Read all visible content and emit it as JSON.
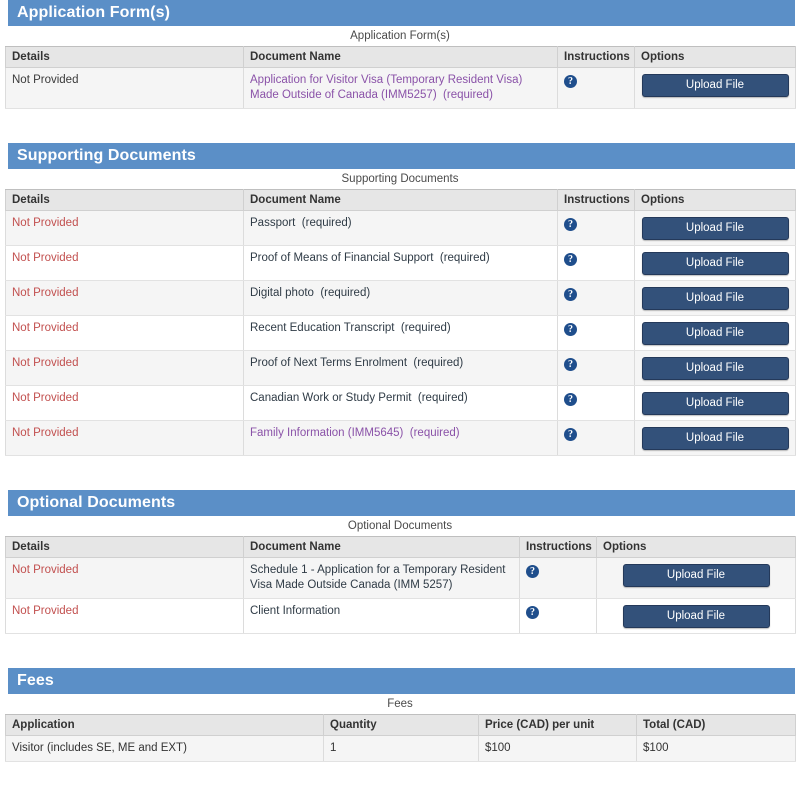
{
  "sections": [
    {
      "id": "application-forms",
      "title": "Application Form(s)",
      "caption": "Application Form(s)",
      "columns": [
        "Details",
        "Document Name",
        "Instructions",
        "Options"
      ],
      "rows": [
        {
          "details": "Not Provided",
          "details_style": "plain",
          "document_name": "Application for Visitor Visa (Temporary Resident Visa) Made Outside of Canada (IMM5257)",
          "required_label": "(required)",
          "name_style": "link",
          "instructions_icon": "help-icon",
          "upload_label": "Upload File"
        }
      ]
    },
    {
      "id": "supporting-documents",
      "title": "Supporting Documents",
      "caption": "Supporting Documents",
      "columns": [
        "Details",
        "Document Name",
        "Instructions",
        "Options"
      ],
      "rows": [
        {
          "details": "Not Provided",
          "details_style": "red",
          "document_name": "Passport",
          "required_label": "(required)",
          "name_style": "plain",
          "instructions_icon": "help-icon",
          "upload_label": "Upload File"
        },
        {
          "details": "Not Provided",
          "details_style": "red",
          "document_name": "Proof of Means of Financial Support",
          "required_label": "(required)",
          "name_style": "plain",
          "instructions_icon": "help-icon",
          "upload_label": "Upload File"
        },
        {
          "details": "Not Provided",
          "details_style": "red",
          "document_name": "Digital photo",
          "required_label": "(required)",
          "name_style": "plain",
          "instructions_icon": "help-icon",
          "upload_label": "Upload File"
        },
        {
          "details": "Not Provided",
          "details_style": "red",
          "document_name": "Recent Education Transcript",
          "required_label": "(required)",
          "name_style": "plain",
          "instructions_icon": "help-icon",
          "upload_label": "Upload File"
        },
        {
          "details": "Not Provided",
          "details_style": "red",
          "document_name": "Proof of Next Terms Enrolment",
          "required_label": "(required)",
          "name_style": "plain",
          "instructions_icon": "help-icon",
          "upload_label": "Upload File"
        },
        {
          "details": "Not Provided",
          "details_style": "red",
          "document_name": "Canadian Work or Study Permit",
          "required_label": "(required)",
          "name_style": "plain",
          "instructions_icon": "help-icon",
          "upload_label": "Upload File"
        },
        {
          "details": "Not Provided",
          "details_style": "red",
          "document_name": "Family Information (IMM5645)",
          "required_label": "(required)",
          "name_style": "link",
          "instructions_icon": "help-icon",
          "upload_label": "Upload File"
        }
      ]
    },
    {
      "id": "optional-documents",
      "title": "Optional Documents",
      "caption": "Optional Documents",
      "columns": [
        "Details",
        "Document Name",
        "Instructions",
        "Options"
      ],
      "rows": [
        {
          "details": "Not Provided",
          "details_style": "red",
          "document_name": "Schedule 1 - Application for a Temporary Resident Visa Made Outside Canada (IMM 5257)",
          "required_label": "",
          "name_style": "plain",
          "instructions_icon": "help-icon",
          "upload_label": "Upload File"
        },
        {
          "details": "Not Provided",
          "details_style": "red",
          "document_name": "Client Information",
          "required_label": "",
          "name_style": "plain",
          "instructions_icon": "help-icon",
          "upload_label": "Upload File"
        }
      ]
    }
  ],
  "fees": {
    "id": "fees",
    "title": "Fees",
    "caption": "Fees",
    "columns": [
      "Application",
      "Quantity",
      "Price (CAD) per unit",
      "Total (CAD)"
    ],
    "rows": [
      {
        "application": "Visitor (includes SE, ME and EXT)",
        "quantity": "1",
        "price": "$100",
        "total": "$100"
      }
    ]
  },
  "icons": {
    "help": "?"
  },
  "colors": {
    "section_bar": "#5b8fc7",
    "upload_button": "#33517a",
    "link": "#8a52a8",
    "not_provided_red": "#c2504f",
    "header_row": "#e6e6e6",
    "alt_row": "#f5f5f5"
  }
}
